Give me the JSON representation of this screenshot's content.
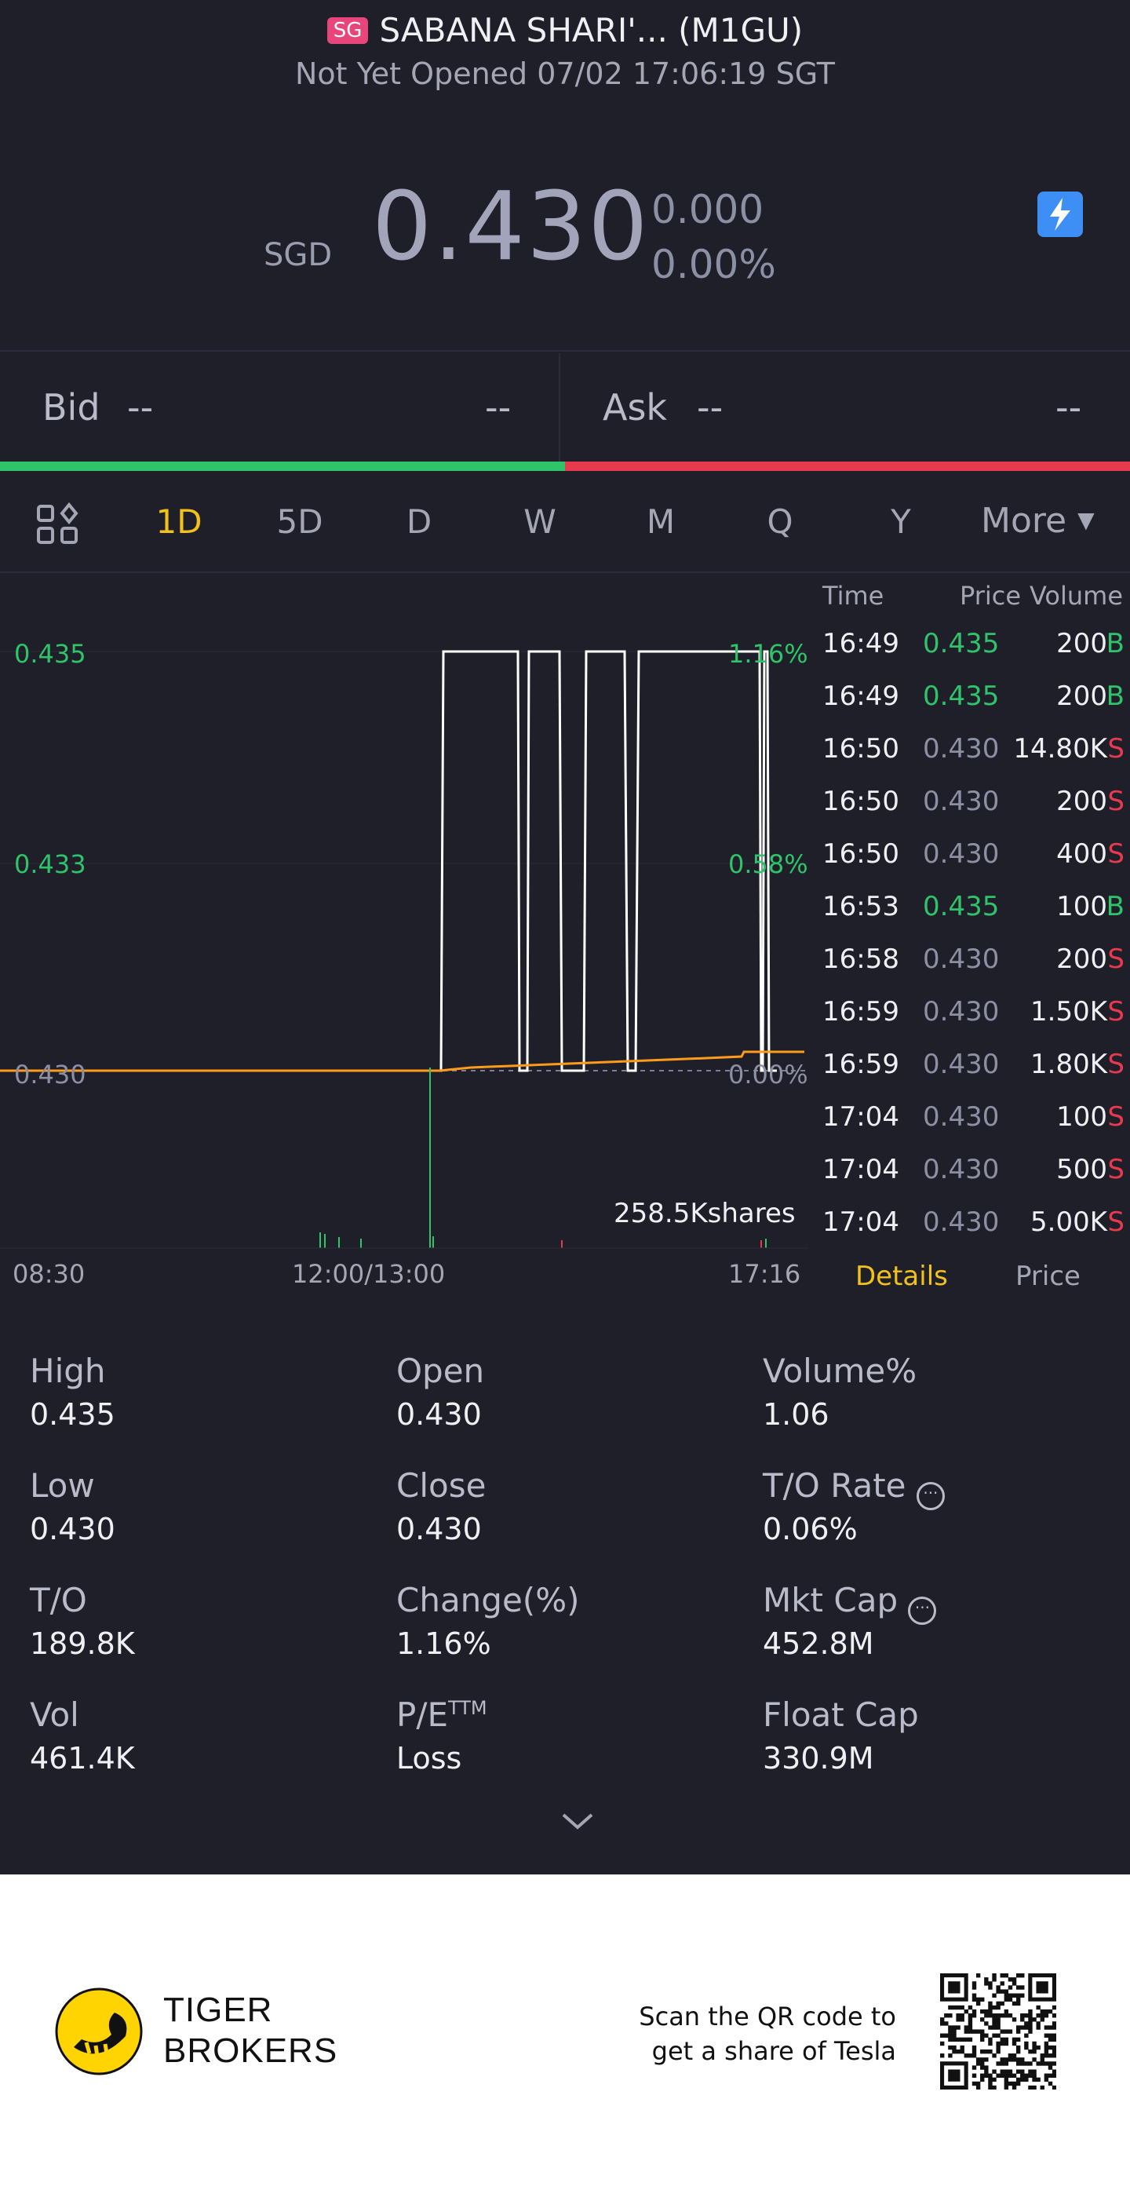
{
  "header": {
    "market_tag": "SG",
    "title": "SABANA SHARI'... (M1GU)",
    "status": "Not Yet Opened 07/02 17:06:19 SGT"
  },
  "quote": {
    "currency": "SGD",
    "price": "0.430",
    "change": "0.000",
    "change_pct": "0.00%",
    "flash_icon": "lightning-icon"
  },
  "bid_ask": {
    "bid_label": "Bid",
    "bid_price": "--",
    "bid_volume": "--",
    "ask_label": "Ask",
    "ask_price": "--",
    "ask_volume": "--"
  },
  "tabs": [
    "1D",
    "5D",
    "D",
    "W",
    "M",
    "Q",
    "Y"
  ],
  "tabs_more": "More",
  "active_tab": "1D",
  "chart": {
    "y_left": [
      "0.435",
      "0.433",
      "0.430"
    ],
    "y_right": [
      "1.16%",
      "0.58%",
      "0.00%"
    ],
    "x_labels": [
      "08:30",
      "12:00/13:00",
      "17:16"
    ],
    "volume_label": "258.5Kshares"
  },
  "chart_data": {
    "type": "line",
    "series": [],
    "ylim": [
      0.43,
      0.435
    ],
    "x_ticks": [
      "08:30",
      "12:00/13:00",
      "17:16"
    ],
    "y_ticks_left": [
      "0.435",
      "0.433",
      "0.430"
    ],
    "y_ticks_right": [
      "1.16%",
      "0.58%",
      "0.00%"
    ]
  },
  "trades": {
    "headers": {
      "time": "Time",
      "price": "Price",
      "volume": "Volume"
    },
    "rows": [
      {
        "time": "16:49",
        "price": "0.435",
        "volume": "200",
        "side": "B"
      },
      {
        "time": "16:49",
        "price": "0.435",
        "volume": "200",
        "side": "B"
      },
      {
        "time": "16:50",
        "price": "0.430",
        "volume": "14.80K",
        "side": "S"
      },
      {
        "time": "16:50",
        "price": "0.430",
        "volume": "200",
        "side": "S"
      },
      {
        "time": "16:50",
        "price": "0.430",
        "volume": "400",
        "side": "S"
      },
      {
        "time": "16:53",
        "price": "0.435",
        "volume": "100",
        "side": "B"
      },
      {
        "time": "16:58",
        "price": "0.430",
        "volume": "200",
        "side": "S"
      },
      {
        "time": "16:59",
        "price": "0.430",
        "volume": "1.50K",
        "side": "S"
      },
      {
        "time": "16:59",
        "price": "0.430",
        "volume": "1.80K",
        "side": "S"
      },
      {
        "time": "17:04",
        "price": "0.430",
        "volume": "100",
        "side": "S"
      },
      {
        "time": "17:04",
        "price": "0.430",
        "volume": "500",
        "side": "S"
      },
      {
        "time": "17:04",
        "price": "0.430",
        "volume": "5.00K",
        "side": "S"
      }
    ],
    "tab_details": "Details",
    "tab_price": "Price"
  },
  "stats": [
    {
      "label": "High",
      "value": "0.435"
    },
    {
      "label": "Open",
      "value": "0.430"
    },
    {
      "label": "Volume%",
      "value": "1.06"
    },
    {
      "label": "Low",
      "value": "0.430"
    },
    {
      "label": "Close",
      "value": "0.430"
    },
    {
      "label": "T/O Rate",
      "value": "0.06%"
    },
    {
      "label": "T/O",
      "value": "189.8K"
    },
    {
      "label": "Change(%)",
      "value": "1.16%"
    },
    {
      "label": "Mkt Cap",
      "value": "452.8M"
    },
    {
      "label": "Vol",
      "value": "461.4K"
    },
    {
      "label": "P/E",
      "sup": "TTM",
      "value": "Loss"
    },
    {
      "label": "Float Cap",
      "value": "330.9M"
    }
  ],
  "footer": {
    "brand_line1": "TIGER",
    "brand_line2": "BROKERS",
    "scan_line1": "Scan the QR code to",
    "scan_line2": "get a share of Tesla"
  },
  "colors": {
    "up": "#2fc36a",
    "down": "#e83a4e",
    "accent": "#f2c21b",
    "background": "#1f1f29"
  }
}
